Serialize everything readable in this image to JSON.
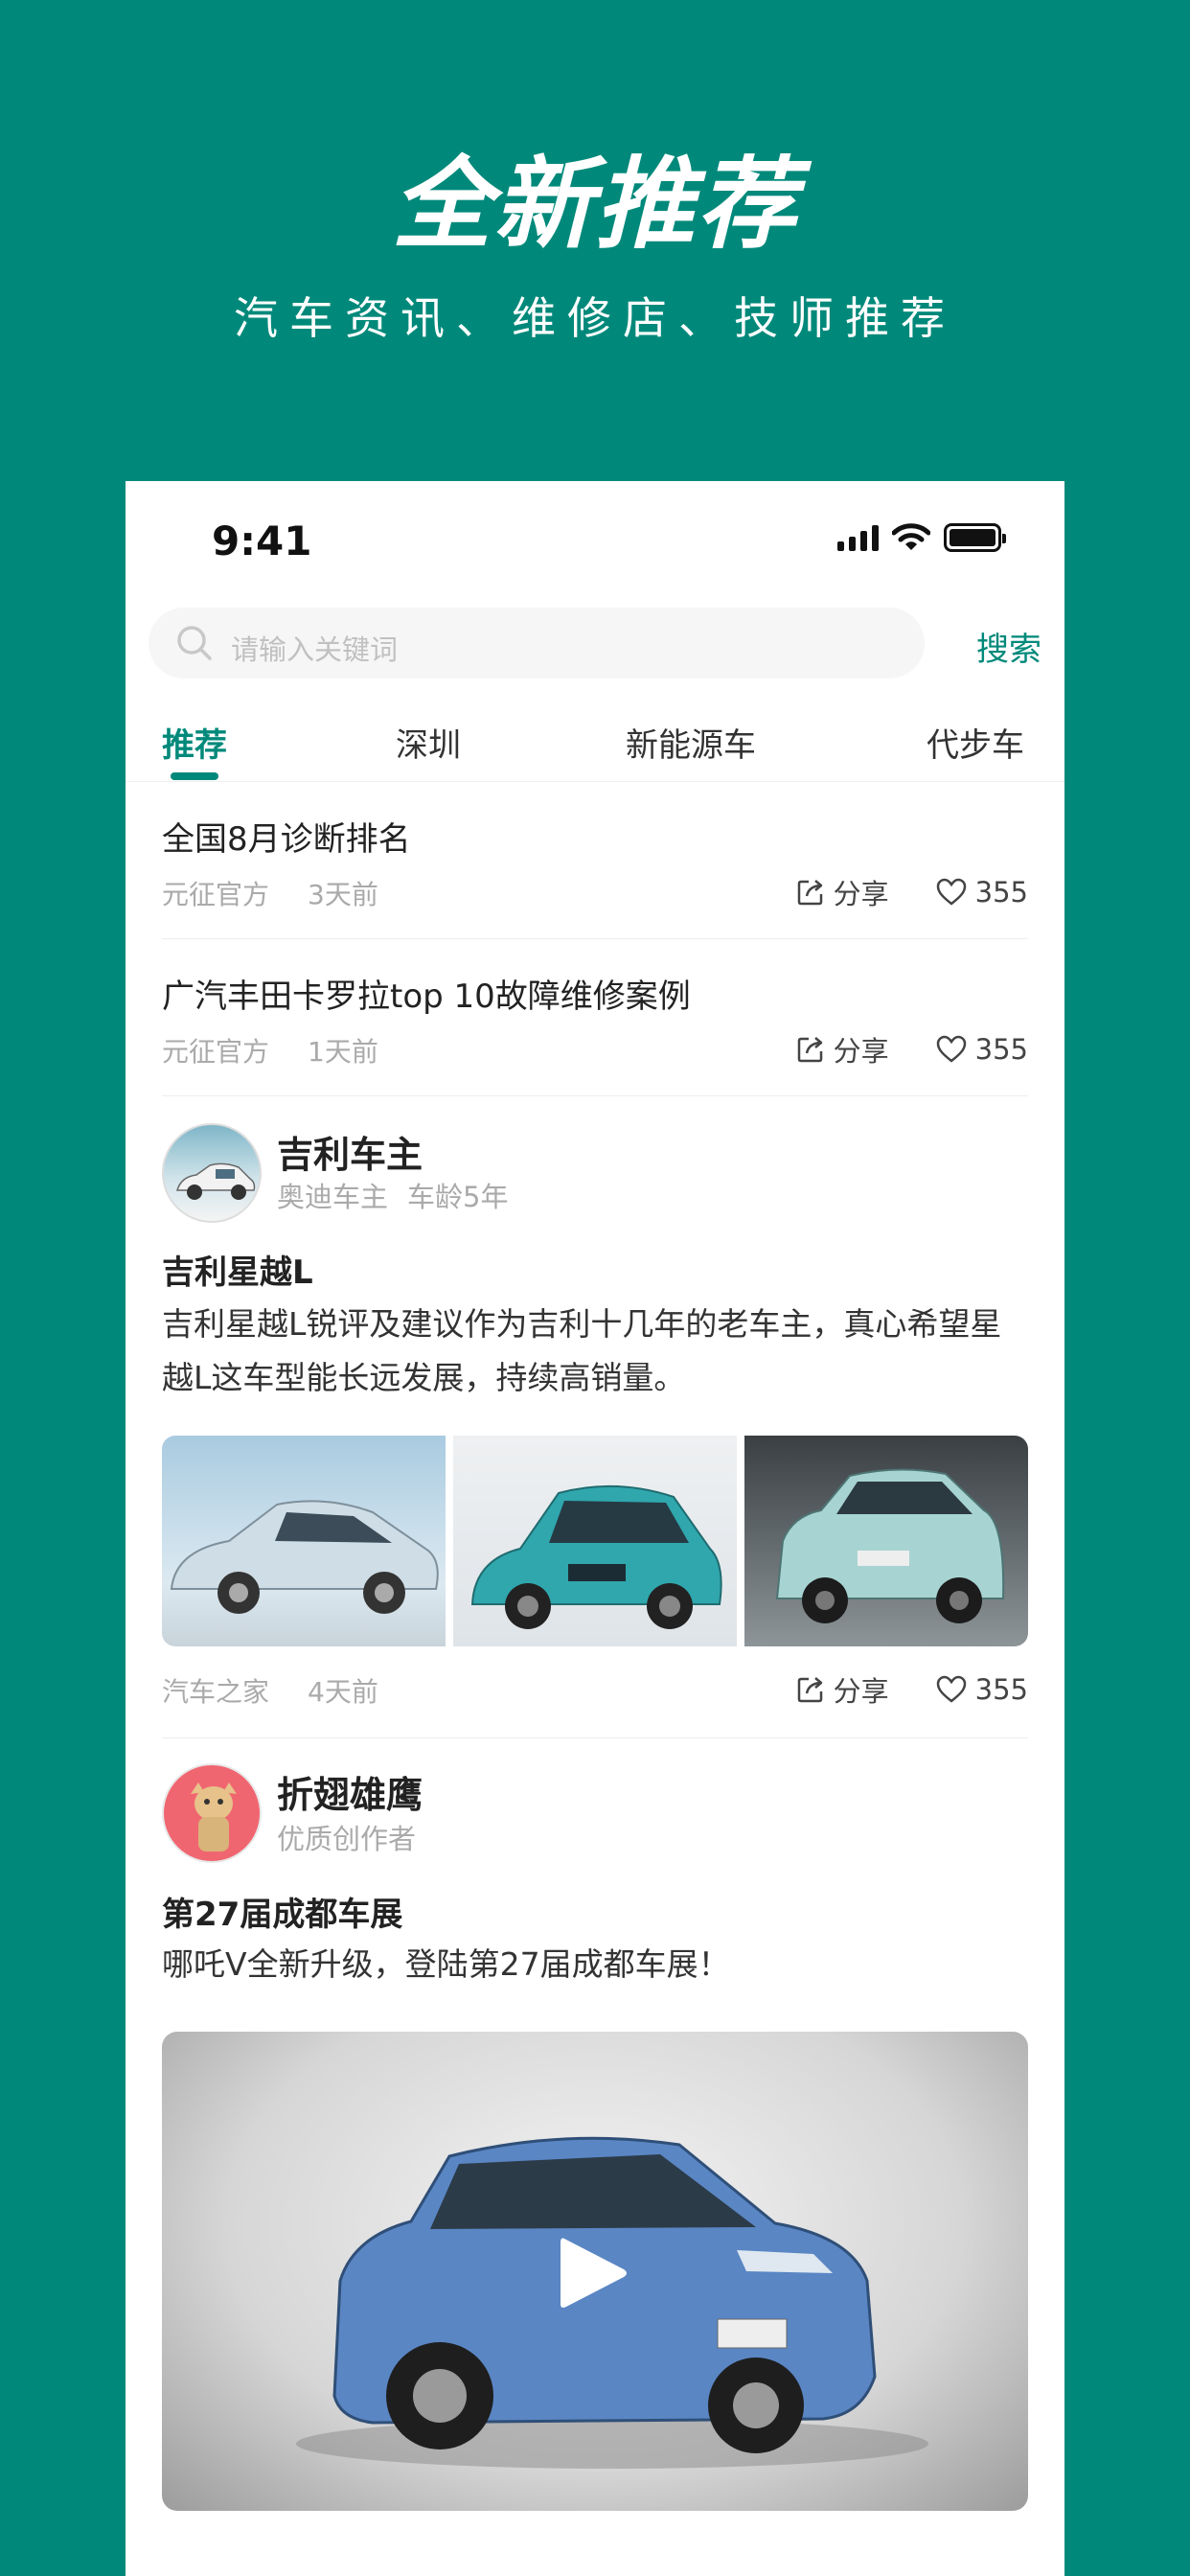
{
  "hero": {
    "title": "全新推荐",
    "subtitle": "汽车资讯、维修店、技师推荐"
  },
  "status_bar": {
    "time": "9:41"
  },
  "search": {
    "placeholder": "请输入关键词",
    "button_label": "搜索"
  },
  "tabs": [
    {
      "label": "推荐",
      "active": true
    },
    {
      "label": "深圳",
      "active": false
    },
    {
      "label": "新能源车",
      "active": false
    },
    {
      "label": "代步车",
      "active": false
    }
  ],
  "news": [
    {
      "title": "全国8月诊断排名",
      "source": "元征官方",
      "time": "3天前",
      "share_label": "分享",
      "likes": "355"
    },
    {
      "title": "广汽丰田卡罗拉top 10故障维修案例",
      "source": "元征官方",
      "time": "1天前",
      "share_label": "分享",
      "likes": "355"
    }
  ],
  "posts": [
    {
      "user": "吉利车主",
      "tags": [
        "奥迪车主",
        "车龄5年"
      ],
      "title": "吉利星越L",
      "body": "吉利星越L锐评及建议作为吉利十几年的老车主，真心希望星越L这车型能长远发展，持续高销量。",
      "source": "汽车之家",
      "time": "4天前",
      "share_label": "分享",
      "likes": "355"
    },
    {
      "user": "折翅雄鹰",
      "tags": [
        "优质创作者"
      ],
      "title": "第27届成都车展",
      "body": "哪吒V全新升级，登陆第27届成都车展！"
    }
  ],
  "colors": {
    "brand": "#00897a",
    "text": "#222222",
    "muted": "#aaaaaa"
  },
  "icons": [
    "search-icon",
    "share-icon",
    "heart-icon",
    "play-icon",
    "wifi-icon",
    "signal-icon",
    "battery-icon"
  ]
}
